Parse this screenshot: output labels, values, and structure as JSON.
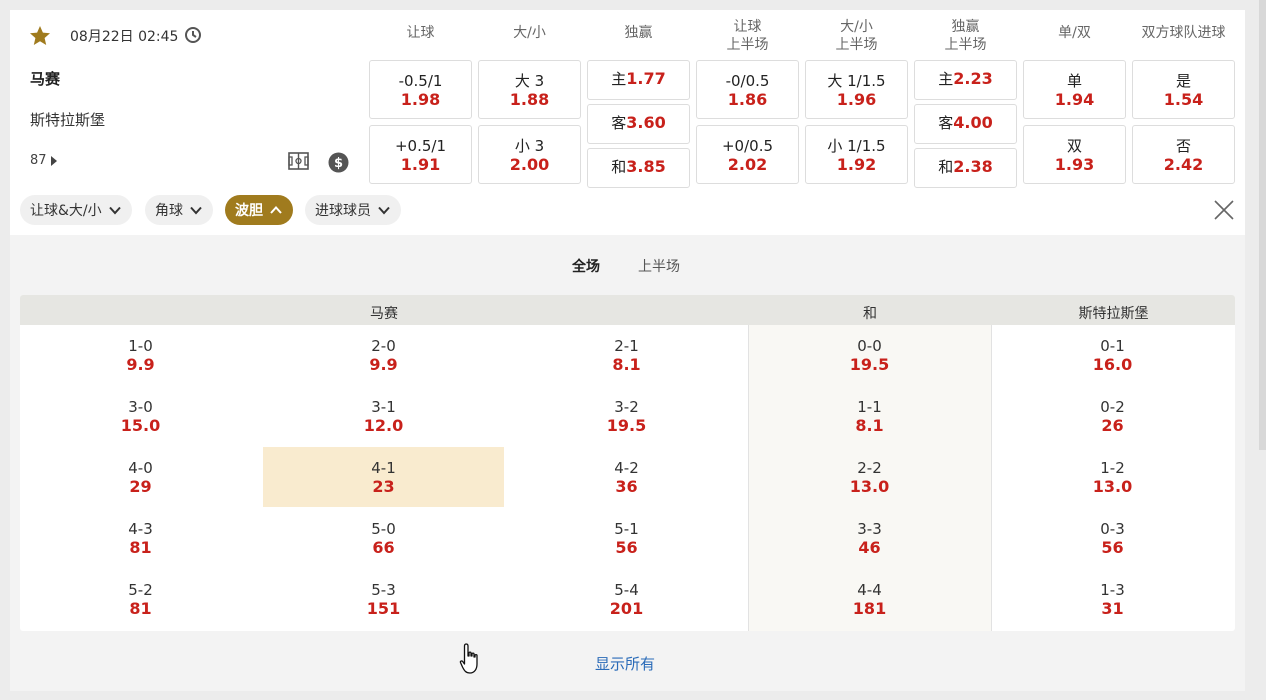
{
  "match": {
    "datetime": "08月22日 02:45",
    "home": "马赛",
    "away": "斯特拉斯堡",
    "minute": "87"
  },
  "columns": [
    "让球",
    "大/小",
    "独赢",
    "让球\n上半场",
    "大/小\n上半场",
    "独赢\n上半场",
    "单/双",
    "双方球队进球"
  ],
  "columns_split": [
    [
      "让球"
    ],
    [
      "大/小"
    ],
    [
      "独赢"
    ],
    [
      "让球",
      "上半场"
    ],
    [
      "大/小",
      "上半场"
    ],
    [
      "独赢",
      "上半场"
    ],
    [
      "单/双"
    ],
    [
      "双方球队进球"
    ]
  ],
  "odds": {
    "handicap": [
      {
        "label": "-0.5/1",
        "value": "1.98"
      },
      {
        "label": "+0.5/1",
        "value": "1.91"
      }
    ],
    "overunder": [
      {
        "label": "大 3",
        "value": "1.88"
      },
      {
        "label": "小 3",
        "value": "2.00"
      }
    ],
    "moneyline": [
      {
        "label": "主",
        "value": "1.77"
      },
      {
        "label": "客",
        "value": "3.60"
      },
      {
        "label": "和",
        "value": "3.85"
      }
    ],
    "handicap_1h": [
      {
        "label": "-0/0.5",
        "value": "1.86"
      },
      {
        "label": "+0/0.5",
        "value": "2.02"
      }
    ],
    "overunder_1h": [
      {
        "label": "大 1/1.5",
        "value": "1.96"
      },
      {
        "label": "小 1/1.5",
        "value": "1.92"
      }
    ],
    "moneyline_1h": [
      {
        "label": "主",
        "value": "2.23"
      },
      {
        "label": "客",
        "value": "4.00"
      },
      {
        "label": "和",
        "value": "2.38"
      }
    ],
    "oddeven": [
      {
        "label": "单",
        "value": "1.94"
      },
      {
        "label": "双",
        "value": "1.93"
      }
    ],
    "btts": [
      {
        "label": "是",
        "value": "1.54"
      },
      {
        "label": "否",
        "value": "2.42"
      }
    ]
  },
  "chips": [
    {
      "label": "让球&大/小",
      "active": false
    },
    {
      "label": "角球",
      "active": false
    },
    {
      "label": "波胆",
      "active": true
    },
    {
      "label": "进球球员",
      "active": false
    }
  ],
  "tabs": [
    {
      "label": "全场",
      "active": true
    },
    {
      "label": "上半场",
      "active": false
    }
  ],
  "correct_score": {
    "headers": {
      "home": "马赛",
      "draw": "和",
      "away": "斯特拉斯堡"
    },
    "columns": [
      [
        {
          "score": "1-0",
          "odd": "9.9"
        },
        {
          "score": "3-0",
          "odd": "15.0"
        },
        {
          "score": "4-0",
          "odd": "29"
        },
        {
          "score": "4-3",
          "odd": "81"
        },
        {
          "score": "5-2",
          "odd": "81"
        }
      ],
      [
        {
          "score": "2-0",
          "odd": "9.9"
        },
        {
          "score": "3-1",
          "odd": "12.0"
        },
        {
          "score": "4-1",
          "odd": "23"
        },
        {
          "score": "5-0",
          "odd": "66"
        },
        {
          "score": "5-3",
          "odd": "151"
        }
      ],
      [
        {
          "score": "2-1",
          "odd": "8.1"
        },
        {
          "score": "3-2",
          "odd": "19.5"
        },
        {
          "score": "4-2",
          "odd": "36"
        },
        {
          "score": "5-1",
          "odd": "56"
        },
        {
          "score": "5-4",
          "odd": "201"
        }
      ],
      [
        {
          "score": "0-0",
          "odd": "19.5"
        },
        {
          "score": "1-1",
          "odd": "8.1"
        },
        {
          "score": "2-2",
          "odd": "13.0"
        },
        {
          "score": "3-3",
          "odd": "46"
        },
        {
          "score": "4-4",
          "odd": "181"
        }
      ],
      [
        {
          "score": "0-1",
          "odd": "16.0"
        },
        {
          "score": "0-2",
          "odd": "26"
        },
        {
          "score": "1-2",
          "odd": "13.0"
        },
        {
          "score": "0-3",
          "odd": "56"
        },
        {
          "score": "1-3",
          "odd": "31"
        }
      ]
    ],
    "highlighted": "4-1"
  },
  "show_all": "显示所有",
  "colors": {
    "accent": "#a07b1e",
    "odd": "#c8211b",
    "link": "#2a6bb8",
    "highlight": "#f9ebcf"
  },
  "icons": [
    "star-icon",
    "clock-icon",
    "pitch-icon",
    "dollar-icon",
    "chevron-down-icon",
    "chevron-up-icon",
    "close-icon",
    "hand-cursor-icon"
  ]
}
